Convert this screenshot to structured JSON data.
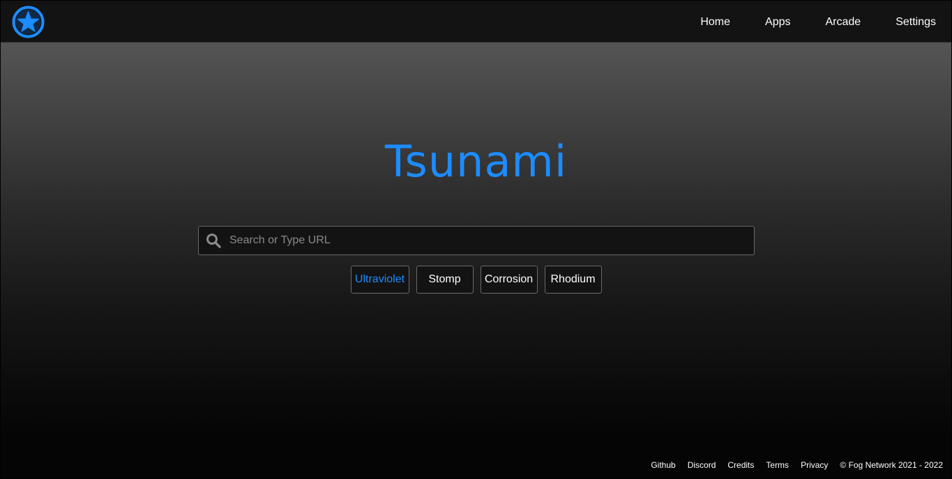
{
  "navbar": {
    "logo": {
      "icon": "star-circle-icon",
      "color": "#1c8cff"
    },
    "links": [
      {
        "label": "Home"
      },
      {
        "label": "Apps"
      },
      {
        "label": "Arcade"
      },
      {
        "label": "Settings"
      }
    ]
  },
  "hero": {
    "title": "Tsunami",
    "title_color": "#1c8cff"
  },
  "search": {
    "icon": "search-icon",
    "placeholder": "Search or Type URL",
    "value": ""
  },
  "proxies": {
    "selected": "Ultraviolet",
    "options": [
      {
        "label": "Ultraviolet"
      },
      {
        "label": "Stomp"
      },
      {
        "label": "Corrosion"
      },
      {
        "label": "Rhodium"
      }
    ]
  },
  "footer": {
    "links": [
      {
        "label": "Github"
      },
      {
        "label": "Discord"
      },
      {
        "label": "Credits"
      },
      {
        "label": "Terms"
      },
      {
        "label": "Privacy"
      }
    ],
    "copyright": "© Fog Network 2021 - 2022"
  }
}
